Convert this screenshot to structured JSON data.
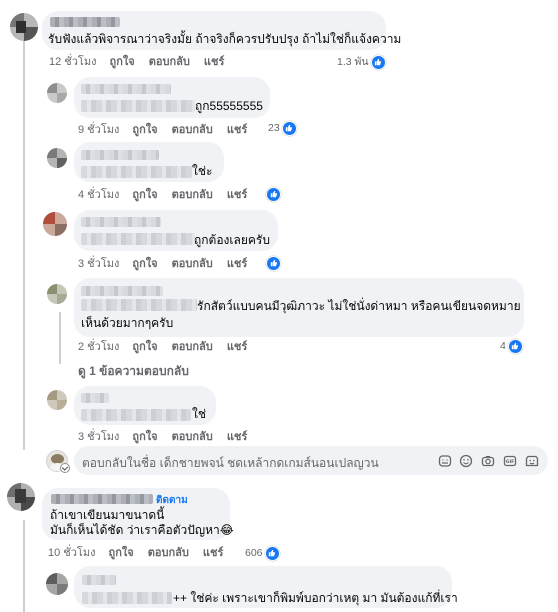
{
  "actions": {
    "like": "ถูกใจ",
    "reply": "ตอบกลับ",
    "share": "แชร์"
  },
  "comments": [
    {
      "text_line1": "รับฟังแล้วพิจารณาว่าจริงมั้ย ถ้าจริงก็ควรปรับปรุง ถ้าไม่ใช่ก็แจ้งความ",
      "time": "12 ชั่วโมง",
      "reactions": "1.3 พัน"
    },
    {
      "text_line1": "ถูก55555555",
      "time": "9 ชั่วโมง",
      "reactions": "23"
    },
    {
      "text_line1": "ใช่ะ",
      "time": "4 ชั่วโมง",
      "reactions": ""
    },
    {
      "text_line1": "ถูกต้องเลยครับ",
      "time": "3 ชั่วโมง",
      "reactions": ""
    },
    {
      "text_line1": "รักสัตว์แบบคนมีวุฒิภาวะ ไม่ใช่นั่งด่าหมา หรือคนเขียนจดหมาย",
      "text_line2": "เห็นด้วยมากๆครับ",
      "time": "2 ชั่วโมง",
      "reactions": "4"
    },
    {
      "text_line1": "ใช่",
      "time": "3 ชั่วโมง",
      "reactions": ""
    },
    {
      "badge": "ติดตาม",
      "text_line1": "ถ้าเขาเขียนมาขนาดนี้",
      "text_line2": "มันก็เห็นได้ชัด ว่าเราคือตัวปัญหา😂",
      "time": "10 ชั่วโมง",
      "reactions": "606"
    },
    {
      "text_line1": "++ ใช่ค่ะ เพราะเขาก็พิมพ์บอกว่าเหตุ มา มันต้องแก้ที่เรา",
      "time": "",
      "reactions": ""
    }
  ],
  "view_replies": "ดู 1 ข้อความตอบกลับ",
  "reply_box": {
    "placeholder": "ตอบกลับในชื่อ เด็กชายพจน์ ชดเหล้ากดเกมส์นอนเปลญวน",
    "icons": [
      "sticker-icon",
      "emoji-icon",
      "camera-icon",
      "gif-icon",
      "avatar-sticker-icon"
    ]
  },
  "colors": {
    "like_blue": "#1877f2",
    "bubble_gray": "#f0f2f5",
    "meta_gray": "#65676b",
    "following_blue": "#1877f2"
  }
}
